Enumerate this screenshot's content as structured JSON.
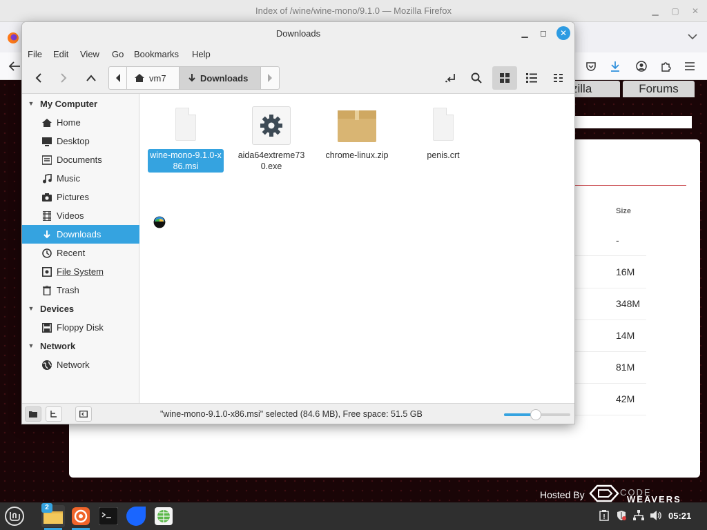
{
  "firefox": {
    "window_title": "Index of /wine/wine-mono/9.1.0 — Mozilla Firefox",
    "nav": [
      "zilla",
      "Forums"
    ],
    "size_header": "Size",
    "sizes": [
      "-",
      "16M",
      "348M",
      "14M",
      "81M",
      "42M"
    ],
    "hosted_by": "Hosted By",
    "logo_code": "CODE",
    "logo_weavers": "WEAVERS"
  },
  "nemo": {
    "title": "Downloads",
    "menu": [
      "File",
      "Edit",
      "View",
      "Go",
      "Bookmarks",
      "Help"
    ],
    "path": {
      "home": "vm7",
      "current": "Downloads"
    },
    "sidebar": {
      "sections": [
        {
          "title": "My Computer",
          "items": [
            {
              "label": "Home",
              "icon": "home-icon"
            },
            {
              "label": "Desktop",
              "icon": "desktop-icon"
            },
            {
              "label": "Documents",
              "icon": "documents-icon"
            },
            {
              "label": "Music",
              "icon": "music-icon"
            },
            {
              "label": "Pictures",
              "icon": "pictures-icon"
            },
            {
              "label": "Videos",
              "icon": "videos-icon"
            },
            {
              "label": "Downloads",
              "icon": "downloads-icon",
              "selected": true
            },
            {
              "label": "Recent",
              "icon": "recent-icon"
            },
            {
              "label": "File System",
              "icon": "file-system-icon"
            },
            {
              "label": "Trash",
              "icon": "trash-icon"
            }
          ]
        },
        {
          "title": "Devices",
          "items": [
            {
              "label": "Floppy Disk",
              "icon": "floppy-icon"
            }
          ]
        },
        {
          "title": "Network",
          "items": [
            {
              "label": "Network",
              "icon": "network-icon"
            }
          ]
        }
      ]
    },
    "files": [
      {
        "name": "wine-mono-9.1.0-x86.msi",
        "type": "document",
        "selected": true
      },
      {
        "name": "aida64extreme730.exe",
        "type": "executable"
      },
      {
        "name": "chrome-linux.zip",
        "type": "archive"
      },
      {
        "name": "penis.crt",
        "type": "document"
      }
    ],
    "status": "\"wine-mono-9.1.0-x86.msi\" selected (84.6 MB), Free space: 51.5 GB",
    "zoom_level": 0.48
  },
  "taskbar": {
    "badge": "2",
    "clock": "05:21"
  },
  "colors": {
    "accent": "#35a3e0",
    "bg_dark_red": "#2a070a"
  }
}
